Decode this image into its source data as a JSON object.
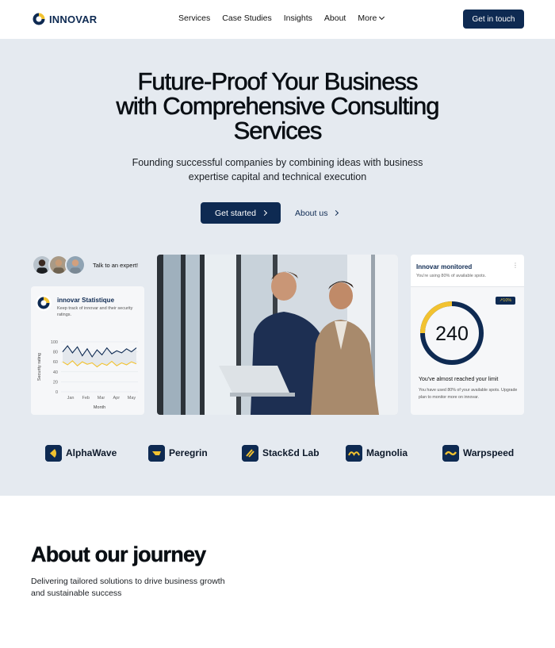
{
  "nav": {
    "logo_text": "INNOVAR",
    "links": [
      "Services",
      "Case Studies",
      "Insights",
      "About"
    ],
    "more_label": "More",
    "cta_label": "Get in touch"
  },
  "hero": {
    "title_lines": [
      "Future-Proof Your Business",
      "with Comprehensive Consulting",
      "Services"
    ],
    "subtitle": "Founding successful companies by combining ideas with business expertise capital and technical execution",
    "primary_cta": "Get started",
    "secondary_cta": "About us",
    "experts_label": "Talk to an expert!"
  },
  "stat_card": {
    "title": "innovar Statistique",
    "description": "Keep track of innovar and their security ratings."
  },
  "monitor_card": {
    "title": "Innovar monitored",
    "subtitle": "You're using 80% of available spots.",
    "badge": "10%",
    "value": "240",
    "usage_fraction": 0.8,
    "limit_text": "You've almost reached your limit",
    "note": "You have used 80% of your available spots. Upgrade plan to monitor more on innovar."
  },
  "brands": [
    "AlphaWave",
    "Peregrin",
    "StackƐd Lab",
    "Magnolia",
    "Warpspeed"
  ],
  "about": {
    "title": "About our journey",
    "subtitle": "Delivering tailored solutions to drive business growth and sustainable success"
  },
  "chart_data": {
    "type": "line",
    "title": "",
    "xlabel": "Month",
    "ylabel": "Security rating",
    "categories": [
      "Jan",
      "Feb",
      "Mar",
      "Apr",
      "May"
    ],
    "yticks": [
      0,
      20,
      40,
      60,
      80,
      100
    ],
    "ylim": [
      0,
      100
    ],
    "grid": true,
    "series": [
      {
        "values": [
          80,
          92,
          78,
          90,
          72,
          86,
          70,
          84,
          74,
          88,
          76,
          82,
          78,
          86,
          80,
          88
        ],
        "color": "#0e2a52"
      },
      {
        "values": [
          60,
          54,
          62,
          52,
          60,
          55,
          58,
          50,
          57,
          53,
          61,
          52,
          58,
          54,
          60,
          56
        ],
        "color": "#f2c230"
      }
    ]
  },
  "colors": {
    "brand_navy": "#0e2a52",
    "accent_yellow": "#f2c230",
    "hero_bg": "#e5eaf0"
  }
}
